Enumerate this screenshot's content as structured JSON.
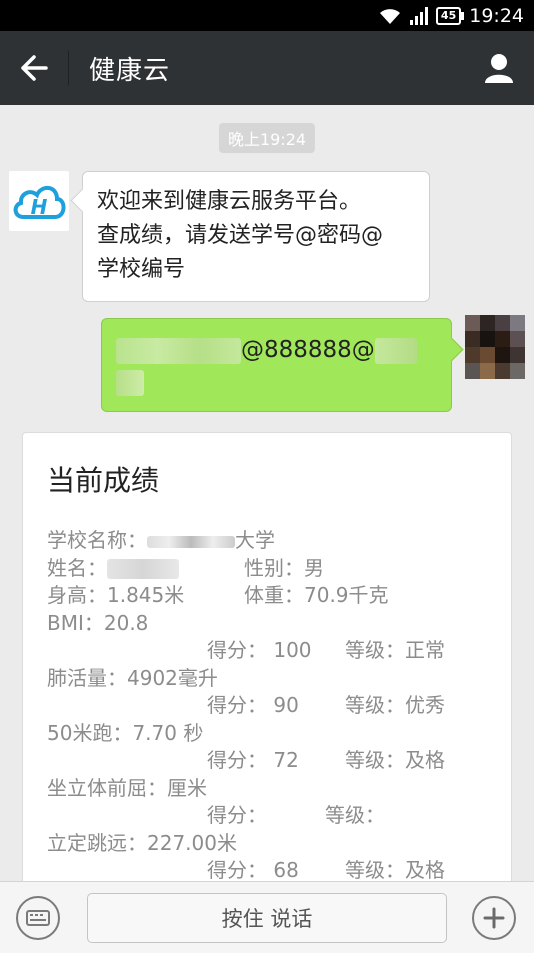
{
  "status_bar": {
    "battery": "45",
    "time": "19:24",
    "icons": [
      "wifi-icon",
      "signal-icon",
      "battery-icon"
    ]
  },
  "header": {
    "title": "健康云",
    "back_icon": "back-arrow-icon",
    "profile_icon": "person-icon"
  },
  "chat": {
    "timestamp": "晚上19:24",
    "incoming": {
      "lines": [
        "欢迎来到健康云服务平台。",
        "查成绩，请发送学号@密码@",
        "学校编号"
      ]
    },
    "outgoing": {
      "visible_text": "@888888@"
    }
  },
  "score_card": {
    "title": "当前成绩",
    "school_label": "学校名称：",
    "school_suffix": "大学",
    "name_label": "姓名：",
    "gender": "性别：男",
    "height": "身高：1.845米",
    "weight": "体重：70.9千克",
    "bmi": "BMI：20.8",
    "bmi_score": "得分： 100",
    "bmi_grade": "等级：正常",
    "lung": "肺活量：4902毫升",
    "lung_score": "得分：  90",
    "lung_grade": "等级：优秀",
    "run50": "50米跑：7.70 秒",
    "run50_score": "得分：  72",
    "run50_grade": "等级：及格",
    "sitreach": "坐立体前屈：厘米",
    "sitreach_score": "得分：",
    "sitreach_grade": "等级：",
    "longjump": "立定跳远：227.00米",
    "longjump_score": "得分：  68",
    "longjump_grade": "等级：及格"
  },
  "input_bar": {
    "hold_to_talk": "按住 说话",
    "keyboard_icon": "keyboard-icon",
    "plus_icon": "plus-icon"
  },
  "colors": {
    "header_bg": "#2f3235",
    "chat_bg": "#ebebeb",
    "outgoing_bubble": "#a0e75a",
    "bot_logo": "#1ea0dc"
  }
}
